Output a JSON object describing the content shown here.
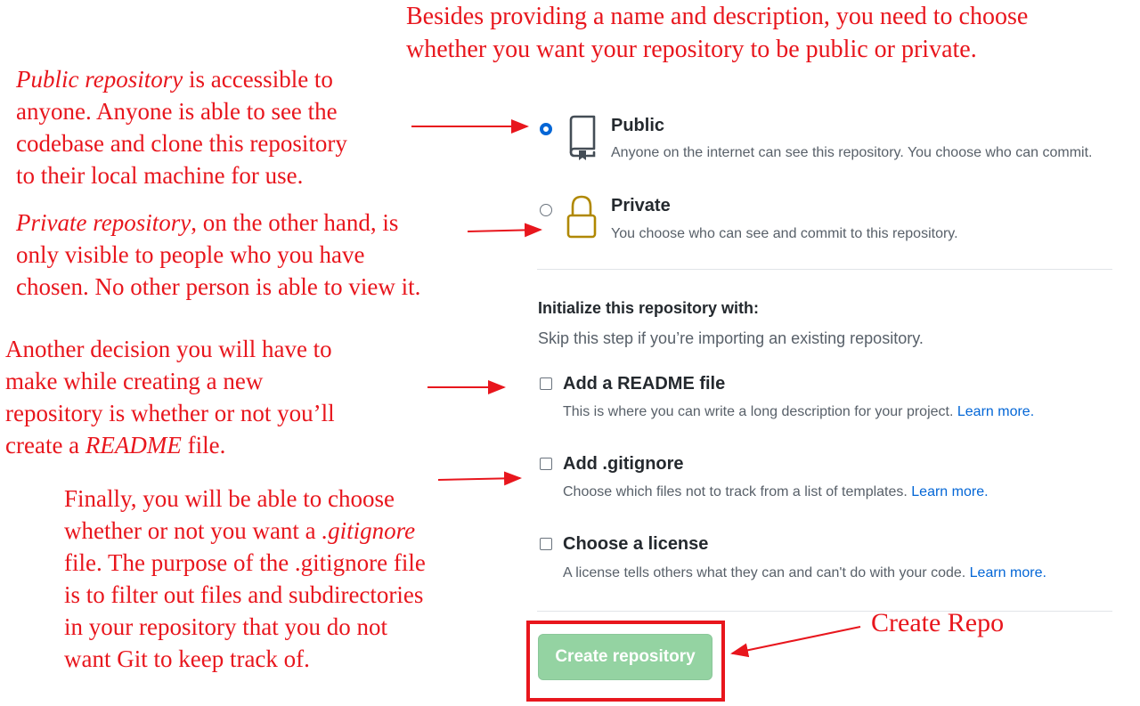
{
  "annotations": {
    "top_line1": "Besides providing a name and description, you need to choose",
    "top_line2": "whether you want your repository to be public or private.",
    "public_term": "Public repository",
    "public_line1_rest": " is accessible to",
    "public_line2": "anyone. Anyone is able to see the",
    "public_line3": "codebase and clone this repository",
    "public_line4": "to their local machine for use.",
    "private_term": "Private repository",
    "private_line1_rest": ", on the other hand, is",
    "private_line2": "only visible to people who you have",
    "private_line3": "chosen. No other person is able to view it.",
    "readme_line1": "Another decision you will have to",
    "readme_line2": "make while creating a new",
    "readme_line3": "repository is whether or not you’ll",
    "readme_line4_pre": "create a ",
    "readme_term": "README",
    "readme_line4_post": " file.",
    "gitignore_line1": "Finally, you will be able to choose",
    "gitignore_line2_pre": "whether or not you want a ",
    "gitignore_term": ".gitignore",
    "gitignore_line3": "file. The purpose of the .gitignore file",
    "gitignore_line4": "is to filter out files and subdirectories",
    "gitignore_line5": "in your repository that you do not",
    "gitignore_line6": "want Git to keep track of.",
    "create_repo": "Create Repo"
  },
  "visibility": {
    "public": {
      "title": "Public",
      "description": "Anyone on the internet can see this repository. You choose who can commit.",
      "icon": "repo-book-icon",
      "selected": true
    },
    "private": {
      "title": "Private",
      "description": "You choose who can see and commit to this repository.",
      "icon": "lock-icon",
      "selected": false
    }
  },
  "initialize": {
    "heading": "Initialize this repository with:",
    "subheading": "Skip this step if you’re importing an existing repository.",
    "readme": {
      "label": "Add a README file",
      "description": "This is where you can write a long description for your project.",
      "link": "Learn more.",
      "checked": false
    },
    "gitignore": {
      "label": "Add .gitignore",
      "description": "Choose which files not to track from a list of templates.",
      "link": "Learn more.",
      "checked": false
    },
    "license": {
      "label": "Choose a license",
      "description": "A license tells others what they can and can't do with your code.",
      "link": "Learn more.",
      "checked": false
    }
  },
  "create_button": {
    "label": "Create repository",
    "enabled": false
  },
  "colors": {
    "annotation": "#e8161d",
    "accent_blue": "#0366d6",
    "lock_gold": "#b08800",
    "button_green_disabled": "#94d3a2"
  }
}
